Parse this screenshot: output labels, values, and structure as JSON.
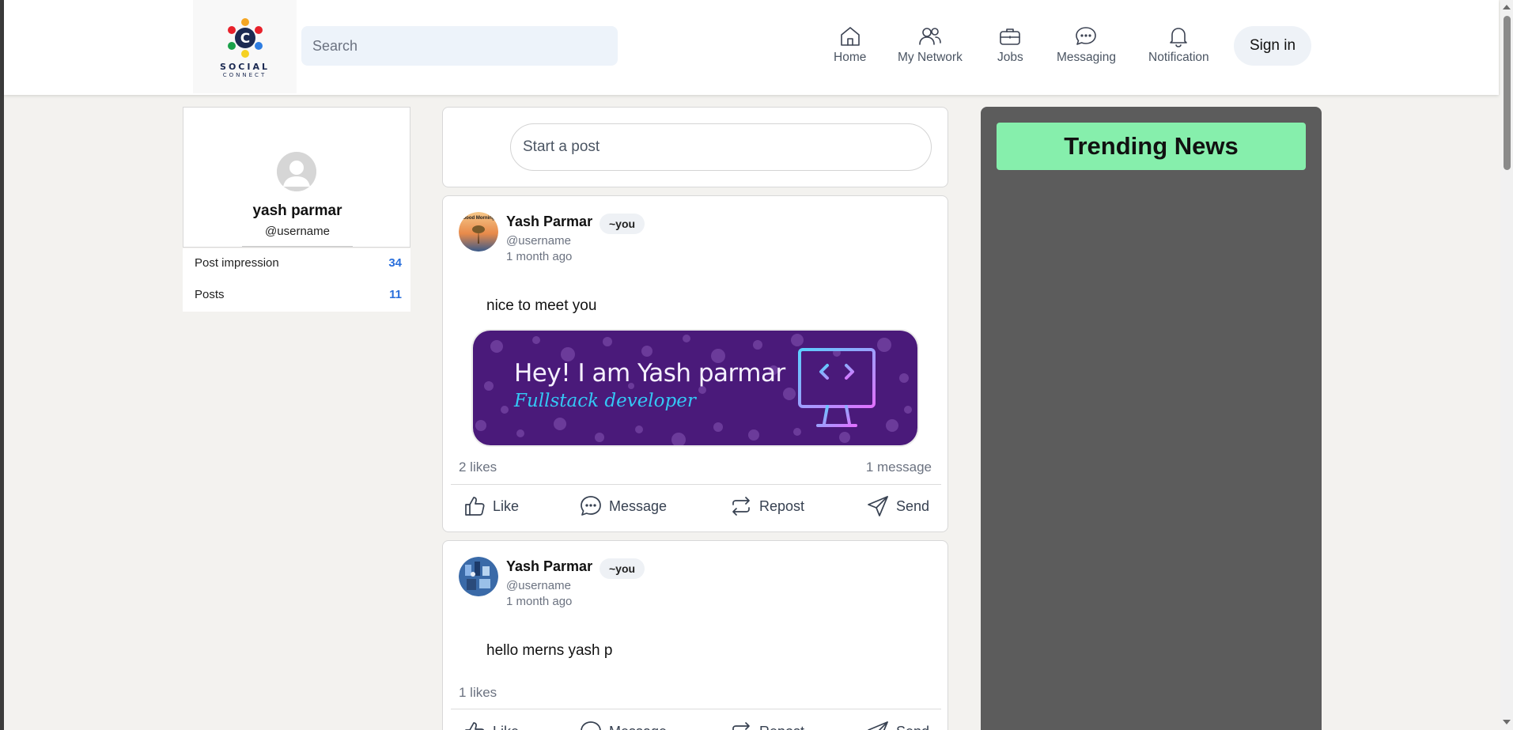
{
  "header": {
    "logo_text": "SOCIAL",
    "logo_subtext": "CONNECT",
    "search_placeholder": "Search",
    "nav": [
      {
        "label": "Home",
        "icon": "home-icon"
      },
      {
        "label": "My Network",
        "icon": "users-icon"
      },
      {
        "label": "Jobs",
        "icon": "briefcase-icon"
      },
      {
        "label": "Messaging",
        "icon": "chat-icon"
      },
      {
        "label": "Notification",
        "icon": "bell-icon"
      }
    ],
    "signin_label": "Sign in"
  },
  "profile": {
    "name": "yash parmar",
    "username": "@username",
    "stats": [
      {
        "label": "Post impression",
        "value": "34"
      },
      {
        "label": "Posts",
        "value": "11"
      }
    ]
  },
  "feed": {
    "start_post_placeholder": "Start a post",
    "posts": [
      {
        "author": "Yash Parmar",
        "badge": "~you",
        "username": "@username",
        "time": "1 month ago",
        "text": "nice to meet you",
        "avatar_text": "Good Morning",
        "banner": {
          "title": "Hey! I am Yash parmar",
          "subtitle": "Fullstack developer"
        },
        "likes": "2 likes",
        "messages": "1 message"
      },
      {
        "author": "Yash Parmar",
        "badge": "~you",
        "username": "@username",
        "time": "1 month ago",
        "text": "hello merns yash p",
        "likes": "1 likes"
      }
    ],
    "actions": {
      "like": "Like",
      "message": "Message",
      "repost": "Repost",
      "send": "Send"
    }
  },
  "trending": {
    "title": "Trending News"
  },
  "colors": {
    "accent_blue": "#2a6fdb",
    "trend_header": "#86efac",
    "trend_panel": "#5c5c5c",
    "banner_bg": "#4a1a7a"
  }
}
